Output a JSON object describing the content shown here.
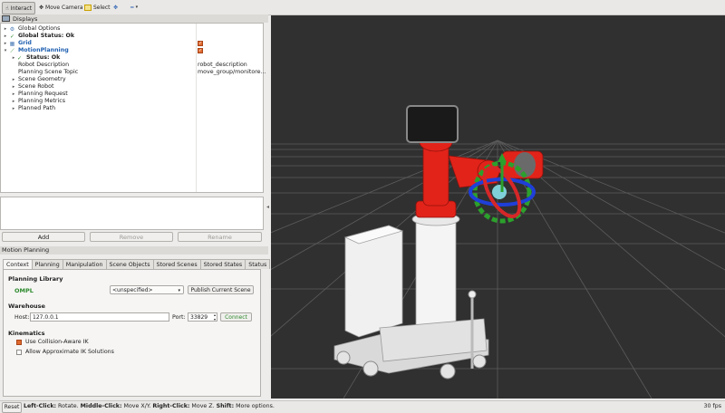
{
  "toolbar": {
    "interact": "Interact",
    "move_camera": "Move Camera",
    "select": "Select"
  },
  "displays": {
    "title": "Displays",
    "items": [
      {
        "label": "Global Options"
      },
      {
        "label": "Global Status: Ok"
      },
      {
        "label": "Grid"
      },
      {
        "label": "MotionPlanning"
      },
      {
        "label": "Status: Ok"
      },
      {
        "label": "Robot Description",
        "value": "robot_description"
      },
      {
        "label": "Planning Scene Topic",
        "value": "move_group/monitore..."
      },
      {
        "label": "Scene Geometry"
      },
      {
        "label": "Scene Robot"
      },
      {
        "label": "Planning Request"
      },
      {
        "label": "Planning Metrics"
      },
      {
        "label": "Planned Path"
      }
    ],
    "buttons": {
      "add": "Add",
      "remove": "Remove",
      "rename": "Rename"
    }
  },
  "motion_planning": {
    "title": "Motion Planning",
    "tabs": [
      "Context",
      "Planning",
      "Manipulation",
      "Scene Objects",
      "Stored Scenes",
      "Stored States",
      "Status"
    ],
    "planning_library": {
      "heading": "Planning Library",
      "library": "OMPL",
      "planner": "<unspecified>",
      "publish_button": "Publish Current Scene"
    },
    "warehouse": {
      "heading": "Warehouse",
      "host_label": "Host:",
      "host": "127.0.0.1",
      "port_label": "Port:",
      "port": "33829",
      "connect_button": "Connect"
    },
    "kinematics": {
      "heading": "Kinematics",
      "use_collision_aware": "Use Collision-Aware IK",
      "use_collision_aware_checked": true,
      "allow_approx": "Allow Approximate IK Solutions",
      "allow_approx_checked": false
    }
  },
  "status_bar": {
    "reset": "Reset",
    "left_click": "Left-Click:",
    "left_desc": " Rotate. ",
    "middle_click": "Middle-Click:",
    "middle_desc": " Move X/Y. ",
    "right_click": "Right-Click:",
    "right_desc": " Move Z. ",
    "shift": "Shift:",
    "shift_desc": " More options.",
    "fps": "30 fps"
  },
  "colors": {
    "robot_red": "#e2231a",
    "viewport_bg": "#303030",
    "checkbox_orange": "#e06a2e",
    "status_ok_green": "#2d8a2d",
    "link_blue": "#1f5fb0"
  }
}
